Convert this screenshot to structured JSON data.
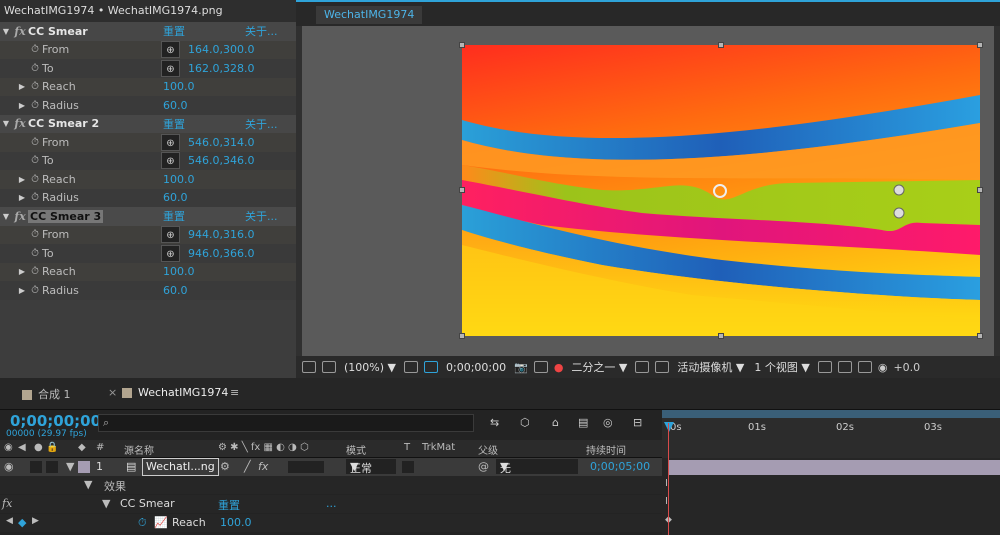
{
  "effects_panel": {
    "title": "WechatIMG1974 • WechatIMG1974.png",
    "effects": [
      {
        "name": "CC Smear",
        "reset": "重置",
        "about": "关于...",
        "from_label": "From",
        "from_value": "164.0,300.0",
        "to_label": "To",
        "to_value": "162.0,328.0",
        "reach_label": "Reach",
        "reach_value": "100.0",
        "radius_label": "Radius",
        "radius_value": "60.0"
      },
      {
        "name": "CC Smear 2",
        "reset": "重置",
        "about": "关于...",
        "from_label": "From",
        "from_value": "546.0,314.0",
        "to_label": "To",
        "to_value": "546.0,346.0",
        "reach_label": "Reach",
        "reach_value": "100.0",
        "radius_label": "Radius",
        "radius_value": "60.0"
      },
      {
        "name": "CC Smear 3",
        "reset": "重置",
        "about": "关于...",
        "from_label": "From",
        "from_value": "944.0,316.0",
        "to_label": "To",
        "to_value": "946.0,366.0",
        "reach_label": "Reach",
        "reach_value": "100.0",
        "radius_label": "Radius",
        "radius_value": "60.0"
      }
    ]
  },
  "viewer": {
    "tab": "WechatIMG1974",
    "zoom": "(100%)",
    "timecode": "0;00;00;00",
    "resolution": "二分之一",
    "camera": "活动摄像机",
    "views": "1 个视图",
    "exposure": "+0.0"
  },
  "timeline": {
    "tabs": [
      "合成 1",
      "WechatIMG1974"
    ],
    "timecode": "0;00;00;00",
    "fps": "00000 (29.97 fps)",
    "columns": {
      "num": "#",
      "source": "源名称",
      "mode": "模式",
      "t": "T",
      "trkmat": "TrkMat",
      "parent": "父级",
      "duration": "持续时间"
    },
    "layer": {
      "index": "1",
      "name": "WechatI...ng",
      "mode": "正常",
      "parent": "无",
      "duration": "0;00;05;00"
    },
    "effects_group": "效果",
    "effect_name": "CC Smear",
    "effect_reset": "重置",
    "effect_more": "...",
    "property": "Reach",
    "property_value": "100.0",
    "ruler": [
      "0s",
      "01s",
      "02s",
      "03s"
    ]
  },
  "colors": {
    "accent": "#2fa3d9",
    "layer_bar": "#a59cb2",
    "playhead": "#d84b4b"
  }
}
